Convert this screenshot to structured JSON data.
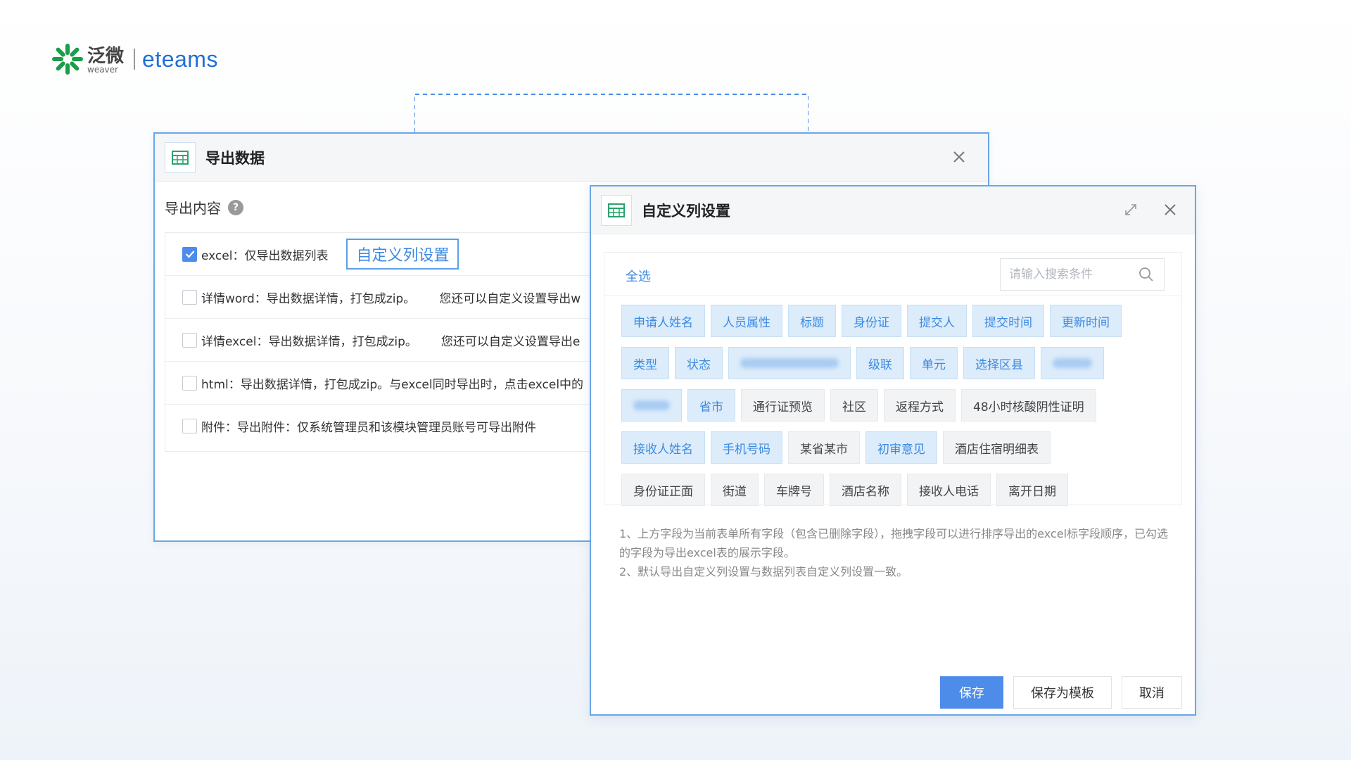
{
  "logo": {
    "brand_cn": "泛微",
    "brand_en": "weaver",
    "product": "eteams"
  },
  "export_dialog": {
    "title": "导出数据",
    "section_label": "导出内容",
    "help_icon_text": "?",
    "options": [
      {
        "label": "excel：仅导出数据列表",
        "checked": true
      },
      {
        "label": "详情word：导出数据详情，打包成zip。",
        "extra": "您还可以自定义设置导出w",
        "checked": false
      },
      {
        "label": "详情excel：导出数据详情，打包成zip。",
        "extra": "您还可以自定义设置导出e",
        "checked": false
      },
      {
        "label": "html：导出数据详情，打包成zip。与excel同时导出时，点击excel中的",
        "checked": false
      },
      {
        "label": "附件：导出附件：仅系统管理员和该模块管理员账号可导出附件",
        "checked": false
      }
    ],
    "custom_column_link": "自定义列设置"
  },
  "column_dialog": {
    "title": "自定义列设置",
    "select_all": "全选",
    "search_placeholder": "请输入搜索条件",
    "tag_rows": [
      [
        {
          "label": "申请人姓名",
          "selected": true
        },
        {
          "label": "人员属性",
          "selected": true
        },
        {
          "label": "标题",
          "selected": true
        },
        {
          "label": "身份证",
          "selected": true
        },
        {
          "label": "提交人",
          "selected": true
        },
        {
          "label": "提交时间",
          "selected": true
        },
        {
          "label": "更新时间",
          "selected": true
        }
      ],
      [
        {
          "label": "类型",
          "selected": true
        },
        {
          "label": "状态",
          "selected": true
        },
        {
          "label": "",
          "selected": true,
          "blurred": true
        },
        {
          "label": "级联",
          "selected": true
        },
        {
          "label": "单元",
          "selected": true
        },
        {
          "label": "选择区县",
          "selected": true
        },
        {
          "label": "",
          "selected": true,
          "blurred": true
        }
      ],
      [
        {
          "label": "",
          "selected": true,
          "blurred": true
        },
        {
          "label": "省市",
          "selected": true
        },
        {
          "label": "通行证预览",
          "selected": false
        },
        {
          "label": "社区",
          "selected": false
        },
        {
          "label": "返程方式",
          "selected": false
        },
        {
          "label": "48小时核酸阴性证明",
          "selected": false
        }
      ],
      [
        {
          "label": "接收人姓名",
          "selected": true
        },
        {
          "label": "手机号码",
          "selected": true
        },
        {
          "label": "某省某市",
          "selected": false
        },
        {
          "label": "初审意见",
          "selected": true
        },
        {
          "label": "酒店住宿明细表",
          "selected": false
        }
      ],
      [
        {
          "label": "身份证正面",
          "selected": false
        },
        {
          "label": "街道",
          "selected": false
        },
        {
          "label": "车牌号",
          "selected": false
        },
        {
          "label": "酒店名称",
          "selected": false
        },
        {
          "label": "接收人电话",
          "selected": false
        },
        {
          "label": "离开日期",
          "selected": false
        }
      ]
    ],
    "notes": [
      "1、上方字段为当前表单所有字段（包含已删除字段），拖拽字段可以进行排序导出的excel标字段顺序，已勾选的字段为导出excel表的展示字段。",
      "2、默认导出自定义列设置与数据列表自定义列设置一致。"
    ],
    "buttons": {
      "save": "保存",
      "save_template": "保存为模板",
      "cancel": "取消"
    }
  },
  "colors": {
    "accent": "#4d8ce8",
    "accent_text": "#3c8ae0",
    "tag_selected_bg": "#dcecfb",
    "tag_unselected_bg": "#f2f3f5",
    "dialog_border": "#6aa6e6",
    "logo_green": "#1a9e4a",
    "logo_blue": "#1f6fd6"
  }
}
